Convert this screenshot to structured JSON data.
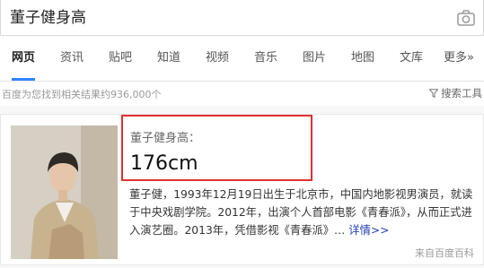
{
  "search": {
    "query": "董子健身高"
  },
  "tabs": [
    {
      "label": "网页"
    },
    {
      "label": "资讯"
    },
    {
      "label": "贴吧"
    },
    {
      "label": "知道"
    },
    {
      "label": "视频"
    },
    {
      "label": "音乐"
    },
    {
      "label": "图片"
    },
    {
      "label": "地图"
    },
    {
      "label": "文库"
    },
    {
      "label": "更多»"
    }
  ],
  "stats": {
    "result_count": "百度为您找到相关结果约936,000个",
    "tools_label": "搜索工具"
  },
  "answer": {
    "label": "董子健身高：",
    "value": "176cm",
    "description": "董子健，1993年12月19日出生于北京市，中国内地影视男演员，就读于中央戏剧学院。2012年，出演个人首部电影《青春派》，从而正式进入演艺圈。2013年，凭借影视《青春派》…",
    "more_link": "详情>>",
    "source": "来自百度百科"
  }
}
